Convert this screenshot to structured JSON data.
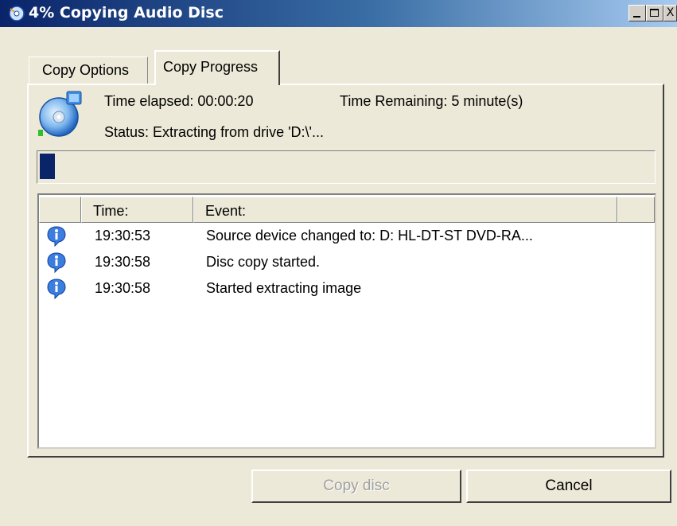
{
  "window": {
    "title": "4% Copying Audio Disc",
    "controls": {
      "minimize": "_",
      "maximize": "□",
      "close": "X"
    }
  },
  "tabs": [
    {
      "label": "Copy Options",
      "active": false
    },
    {
      "label": "Copy Progress",
      "active": true
    }
  ],
  "status": {
    "time_elapsed": "Time elapsed: 00:00:20",
    "time_remaining": "Time Remaining: 5 minute(s)",
    "status_text": "Status: Extracting from drive 'D:\\'..."
  },
  "progress": {
    "percent": 4
  },
  "event_list": {
    "columns": [
      "",
      "Time:",
      "Event:",
      ""
    ],
    "rows": [
      {
        "icon": "info-icon",
        "time": "19:30:53",
        "event": "Source device changed to: D: HL-DT-ST DVD-RA..."
      },
      {
        "icon": "info-icon",
        "time": "19:30:58",
        "event": "Disc copy started."
      },
      {
        "icon": "info-icon",
        "time": "19:30:58",
        "event": "Started extracting image"
      }
    ]
  },
  "buttons": {
    "copy_disc": {
      "label": "Copy disc",
      "enabled": false
    },
    "cancel": {
      "label": "Cancel",
      "enabled": true
    }
  },
  "colors": {
    "titlebar_start": "#0a246a",
    "progress_block": "#0a246a",
    "face": "#ece9d8"
  }
}
